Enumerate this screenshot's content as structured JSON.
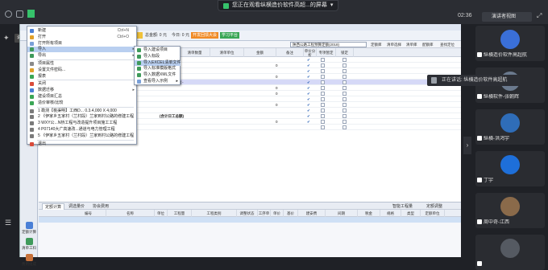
{
  "meeting": {
    "share_banner": "您正在观看纵横造价软件高超...的屏幕",
    "clock": "02:36",
    "speaker_view": "演讲者视图",
    "now_speaking": "正在讲话: 纵横造价软件高超航"
  },
  "left_rail": {
    "pin_label": "说话隐藏"
  },
  "toolbar": {
    "total": "总金额: 0 元",
    "fee": "今日: 0 元",
    "chip_orange": "开发回馈大会",
    "chip_green": "学习平台"
  },
  "left_panel": [
    "定额计算",
    "清单工料",
    "费用组成"
  ],
  "grid": {
    "combo": "陕西公路工程预算定额(2018)",
    "toolbar_buttons": [
      "定额库",
      "清单选择",
      "清单库",
      "配额库",
      "查找定位"
    ],
    "headers": [
      "清单数量",
      "清单单位",
      "金额",
      "备注",
      "单价分析",
      "专项暂定",
      "锁定"
    ],
    "rows": [
      {
        "text": "",
        "mark": "",
        "check": "✔"
      },
      {
        "text": "",
        "mark": "0",
        "check": "✔"
      },
      {
        "text": "",
        "mark": "",
        "check": "✔"
      },
      {
        "text": "",
        "mark": "0",
        "check": "✔"
      },
      {
        "text": "材料、工程量 ·",
        "mark": "",
        "check": "✔"
      },
      {
        "text": "",
        "mark": "0",
        "check": "✔"
      },
      {
        "text": "",
        "mark": "0",
        "check": "✔"
      },
      {
        "text": "",
        "mark": "",
        "check": "✔"
      },
      {
        "text": "",
        "mark": "0",
        "check": "✔"
      },
      {
        "text": "",
        "mark": "",
        "check": "✔"
      },
      {
        "text": "(合计日工总额)",
        "mark": "",
        "check": "✔"
      },
      {
        "text": "",
        "mark": "0",
        "check": "✔"
      },
      {
        "text": "",
        "mark": "",
        "check": ""
      }
    ]
  },
  "menu": {
    "items": [
      {
        "label": "新建",
        "key": "Ctrl+N",
        "arrow": ""
      },
      {
        "label": "打开",
        "key": "Ctrl+O",
        "arrow": ""
      },
      {
        "label": "打开所有项目",
        "key": "",
        "arrow": ""
      },
      {
        "label": "导入",
        "key": "",
        "arrow": "▸"
      },
      {
        "label": "导出",
        "key": "",
        "arrow": "▸"
      },
      {
        "label": "项目属性",
        "key": "",
        "arrow": ""
      },
      {
        "label": "设置文件密码...",
        "key": "",
        "arrow": ""
      },
      {
        "label": "报表",
        "key": "",
        "arrow": ""
      },
      {
        "label": "关闭",
        "key": "",
        "arrow": ""
      },
      {
        "label": "数据迁移",
        "key": "",
        "arrow": "▸"
      },
      {
        "label": "建设项目汇总",
        "key": "",
        "arrow": ""
      },
      {
        "label": "造价审核/比较",
        "key": "",
        "arrow": ""
      },
      {
        "label": "1 勘测【桃渠明】工西D...  0.3.4,000 X 4,000",
        "key": "",
        "arrow": ""
      },
      {
        "label": "2 《伊家乡五家村（兰村段）兰家到村公路的修建工程",
        "key": "",
        "arrow": ""
      },
      {
        "label": "3 WXY公...N桥工程与改造提升项目施工工程",
        "key": "",
        "arrow": ""
      },
      {
        "label": "4 P07140大广高速改...通道与电力管理工程",
        "key": "",
        "arrow": ""
      },
      {
        "label": "5 《伊家乡五家村（兰村段）兰家到村公路的修建工程",
        "key": "",
        "arrow": ""
      },
      {
        "label": "退出",
        "key": "",
        "arrow": ""
      }
    ],
    "submenu": [
      {
        "label": "导入建设项目",
        "arrow": ""
      },
      {
        "label": "导入标段",
        "arrow": ""
      },
      {
        "label": "导入EXCEL清单文件",
        "arrow": ""
      },
      {
        "label": "导入标准模版格式",
        "arrow": ""
      },
      {
        "label": "导入数据XML文件",
        "arrow": ""
      },
      {
        "label": "查看导入示例",
        "arrow": "▸"
      }
    ]
  },
  "bottom": {
    "tabs": [
      "定额计算",
      "调选量价",
      "协会费用"
    ],
    "right_buttons": [
      "智能工程量",
      "定额调整"
    ],
    "headers": [
      "编号",
      "名称",
      "单位",
      "工程量",
      "工程类别",
      "调整状态",
      "工序单价",
      "单价",
      "基价",
      "建安费",
      "间期",
      "税金",
      "规格",
      "类型",
      "定额单位"
    ]
  },
  "participants": [
    {
      "name": "纵横造价软件高超航",
      "color": "#3a6fd8"
    },
    {
      "name": "纵横软件-张朝辉",
      "color": "#6b7a8e"
    },
    {
      "name": "纵横-洪鸿宇",
      "color": "#2f6db8"
    },
    {
      "name": "丁宇",
      "color": "#1e6fd9"
    },
    {
      "name": "周中奇-江西",
      "color": "#8a6a4a"
    },
    {
      "name": "",
      "color": "#555a62"
    }
  ]
}
